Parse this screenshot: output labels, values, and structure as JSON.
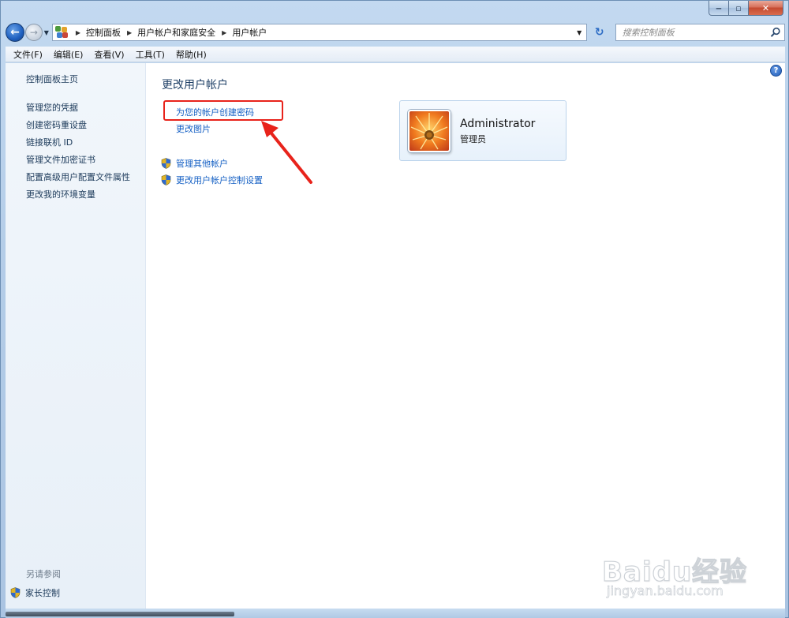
{
  "window": {
    "minimize_glyph": "‒",
    "maximize_glyph": "▫",
    "close_glyph": "✕"
  },
  "address_bar": {
    "breadcrumbs": [
      "控制面板",
      "用户帐户和家庭安全",
      "用户帐户"
    ],
    "search_placeholder": "搜索控制面板"
  },
  "menu": {
    "items": [
      "文件(F)",
      "编辑(E)",
      "查看(V)",
      "工具(T)",
      "帮助(H)"
    ]
  },
  "sidebar": {
    "home": "控制面板主页",
    "links": [
      "管理您的凭据",
      "创建密码重设盘",
      "链接联机 ID",
      "管理文件加密证书",
      "配置高级用户配置文件属性",
      "更改我的环境变量"
    ],
    "see_also": "另请参阅",
    "parental_controls": "家长控制"
  },
  "main": {
    "title": "更改用户帐户",
    "tasks": {
      "create_password": "为您的帐户创建密码",
      "change_picture": "更改图片",
      "manage_other": "管理其他帐户",
      "uac_settings": "更改用户帐户控制设置"
    },
    "help": "?"
  },
  "user": {
    "name": "Administrator",
    "role": "管理员"
  },
  "watermark": {
    "main": "Baidu经验",
    "sub": "jingyan.baidu.com"
  },
  "colors": {
    "link": "#1560c4",
    "highlight_box": "#e8231b",
    "title": "#1e3f66"
  }
}
